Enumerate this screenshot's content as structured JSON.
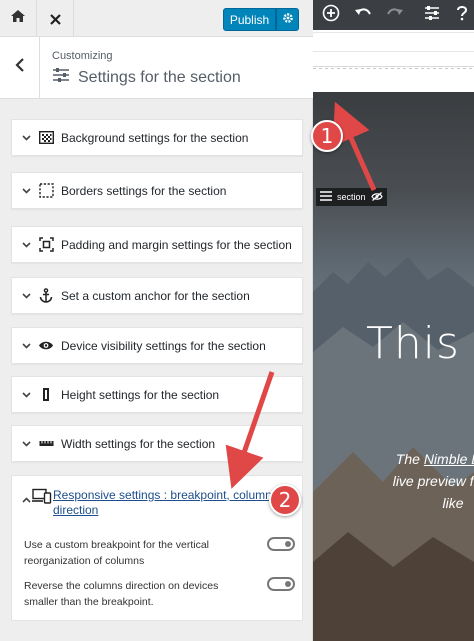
{
  "topbar": {
    "publish_label": "Publish"
  },
  "header": {
    "breadcrumb": "Customizing",
    "title": "Settings for the section"
  },
  "accordions": [
    {
      "label": "Background settings for the section",
      "icon": "background-icon"
    },
    {
      "label": "Borders settings for the section",
      "icon": "borders-icon"
    },
    {
      "label": "Padding and margin settings for the section",
      "icon": "padding-icon"
    },
    {
      "label": "Set a custom anchor for the section",
      "icon": "anchor-icon"
    },
    {
      "label": "Device visibility settings for the section",
      "icon": "eye-icon"
    },
    {
      "label": "Height settings for the section",
      "icon": "height-icon"
    },
    {
      "label": "Width settings for the section",
      "icon": "width-icon"
    }
  ],
  "responsive": {
    "label": "Responsive settings : breakpoint, column direction",
    "icon": "devices-icon",
    "options": [
      {
        "label": "Use a custom breakpoint for the vertical reorganization of columns",
        "enabled": false
      },
      {
        "label": "Reverse the columns direction on devices smaller than the breakpoint.",
        "enabled": false
      }
    ]
  },
  "preview": {
    "section_handle_label": "section",
    "hero_title": "This p",
    "hero_text_prefix": "The ",
    "hero_text_link": "Nimble Builde",
    "hero_text_line2": "live preview from th",
    "hero_text_line3": "like"
  },
  "annotations": {
    "badge_1": "1",
    "badge_2": "2",
    "color": "#e04848"
  },
  "colors": {
    "publish": "#0085ba",
    "panel_bg": "#eeeeee",
    "preview_toolbar": "#3b3f44"
  }
}
